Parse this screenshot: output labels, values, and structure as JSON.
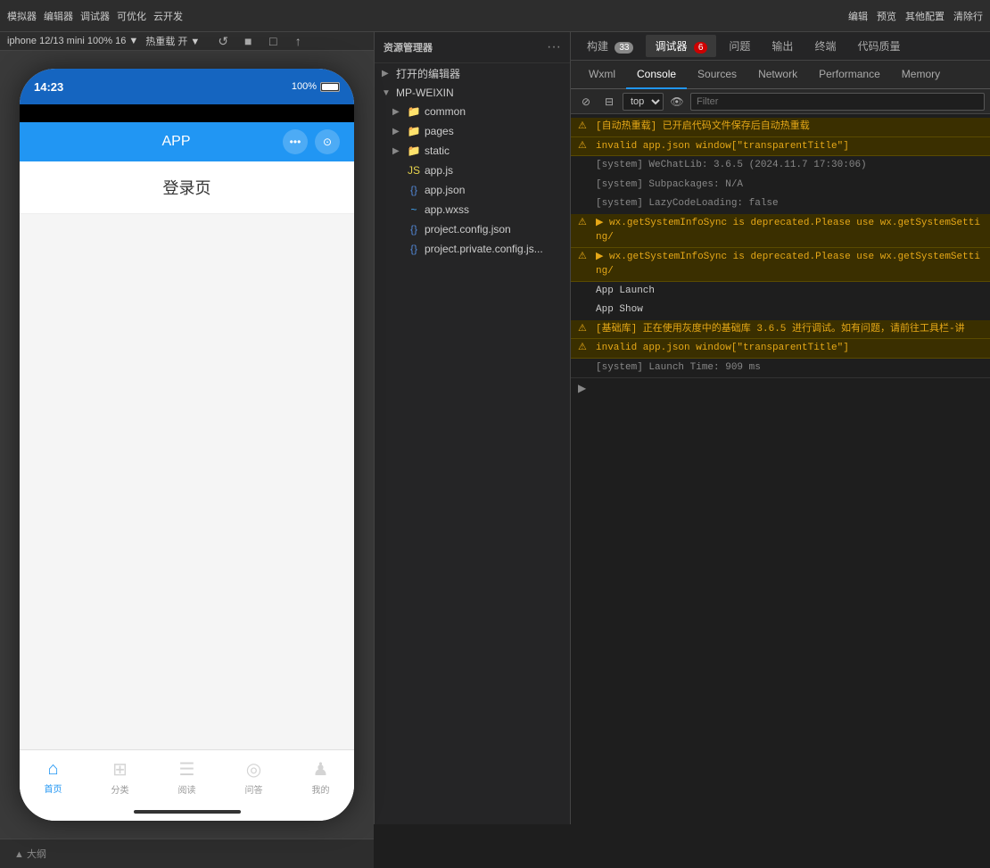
{
  "topbar": {
    "left_items": [
      "模拟器",
      "编辑器",
      "调试器",
      "可优化",
      "云开发"
    ],
    "right_items": [
      "编辑",
      "预览",
      "其他配置",
      "清除行"
    ],
    "device_label": "iphone 12/13 mini 100% 16 ▼",
    "hot_reload": "热重载 开 ▼"
  },
  "secondary_toolbar": {
    "reload_icons": [
      "↺",
      "■",
      "□",
      "↑"
    ]
  },
  "phone": {
    "status_time": "14:23",
    "battery": "100%",
    "app_title": "APP",
    "page_title": "登录页",
    "tabs": [
      {
        "label": "首页",
        "icon": "⌂",
        "active": true
      },
      {
        "label": "分类",
        "icon": "⊞",
        "active": false
      },
      {
        "label": "阅读",
        "icon": "☰",
        "active": false
      },
      {
        "label": "问答",
        "icon": "◎",
        "active": false
      },
      {
        "label": "我的",
        "icon": "♟",
        "active": false
      }
    ]
  },
  "explorer": {
    "title": "资源管理器",
    "sections": {
      "open_editor": "打开的编辑器",
      "project": "MP-WEIXIN"
    },
    "tree": [
      {
        "name": "common",
        "type": "folder",
        "depth": 1,
        "expanded": false
      },
      {
        "name": "pages",
        "type": "folder",
        "depth": 1,
        "expanded": false
      },
      {
        "name": "static",
        "type": "folder",
        "depth": 1,
        "expanded": false
      },
      {
        "name": "app.js",
        "type": "file-js",
        "depth": 1
      },
      {
        "name": "app.json",
        "type": "file-json",
        "depth": 1
      },
      {
        "name": "app.wxss",
        "type": "file-wxss",
        "depth": 1
      },
      {
        "name": "project.config.json",
        "type": "file-json",
        "depth": 1
      },
      {
        "name": "project.private.config.js...",
        "type": "file-json",
        "depth": 1
      }
    ]
  },
  "debug_tabs": [
    {
      "label": "构建",
      "badge": "33",
      "badge_type": "normal"
    },
    {
      "label": "调试器",
      "badge": "6",
      "badge_type": "red"
    },
    {
      "label": "问题",
      "badge": "",
      "badge_type": ""
    },
    {
      "label": "输出",
      "badge": "",
      "badge_type": ""
    },
    {
      "label": "终端",
      "badge": "",
      "badge_type": ""
    },
    {
      "label": "代码质量",
      "badge": "",
      "badge_type": ""
    }
  ],
  "devtools_tabs": [
    {
      "label": "Wxml"
    },
    {
      "label": "Console",
      "active": true
    },
    {
      "label": "Sources"
    },
    {
      "label": "Network"
    },
    {
      "label": "Performance"
    },
    {
      "label": "Memory"
    }
  ],
  "console": {
    "filter_placeholder": "Filter",
    "context": "top",
    "lines": [
      {
        "type": "warn",
        "text": "[自动热重载] 已开启代码文件保存后自动热重载"
      },
      {
        "type": "warn",
        "text": "invalid app.json window[\"transparentTitle\"]"
      },
      {
        "type": "info",
        "text": "[system] WeChatLib: 3.6.5 (2024.11.7 17:30:06)"
      },
      {
        "type": "info",
        "text": "[system] Subpackages: N/A"
      },
      {
        "type": "info",
        "text": "[system] LazyCodeLoading: false"
      },
      {
        "type": "warn",
        "text": "▶ wx.getSystemInfoSync is deprecated.Please use wx.getSystemSetting/"
      },
      {
        "type": "warn",
        "text": "▶ wx.getSystemInfoSync is deprecated.Please use wx.getSystemSetting/"
      },
      {
        "type": "info",
        "text": "App Launch"
      },
      {
        "type": "info",
        "text": "App Show"
      },
      {
        "type": "warn",
        "text": "[基础库] 正在使用灰度中的基础库 3.6.5 进行调试。如有问题，请前往工具栏-讲"
      },
      {
        "type": "warn",
        "text": "invalid app.json window[\"transparentTitle\"]"
      },
      {
        "type": "info",
        "text": "[system] Launch Time: 909 ms"
      }
    ]
  }
}
